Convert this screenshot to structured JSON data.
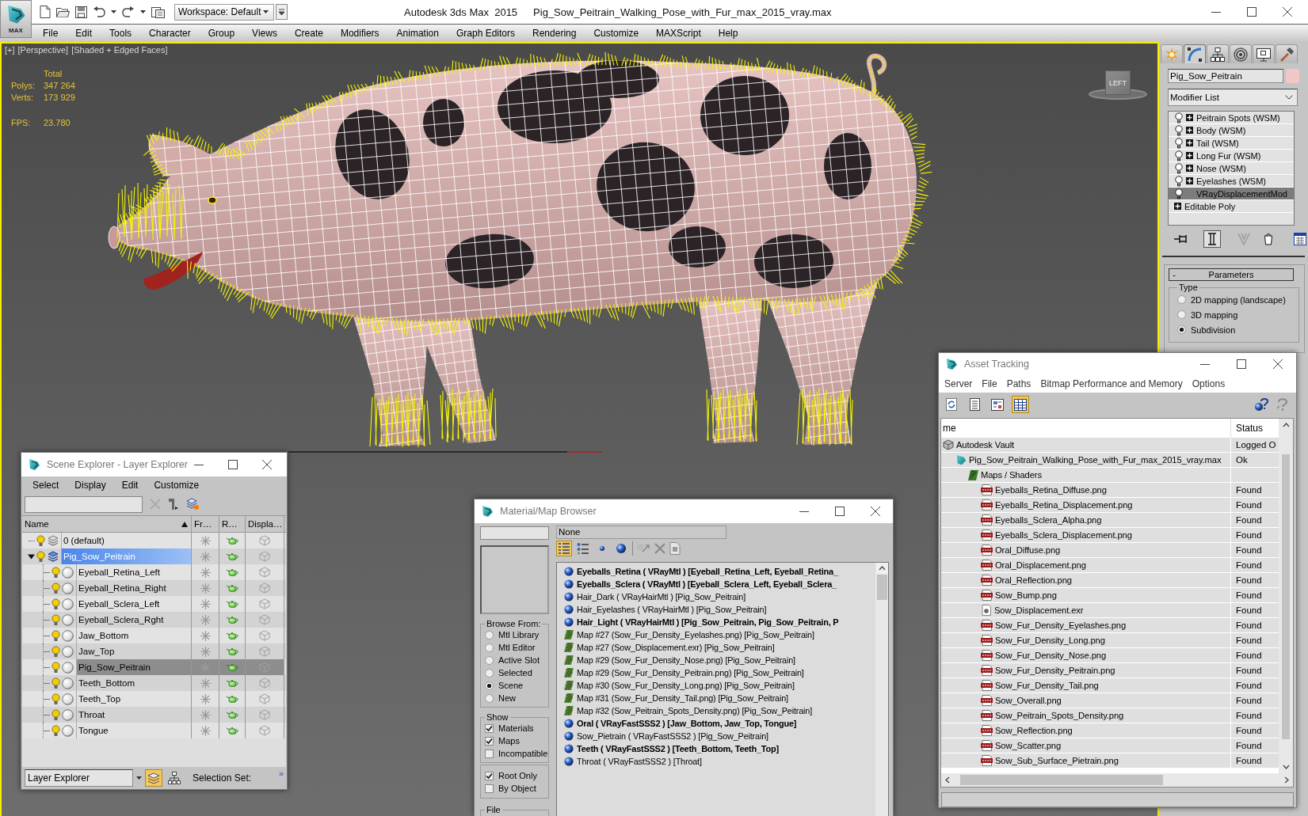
{
  "title_bar": {
    "logo_text": "MAX",
    "workspace": "Workspace: Default",
    "app_name": "Autodesk 3ds Max  2015",
    "file_name": "Pig_Sow_Peitrain_Walking_Pose_with_Fur_max_2015_vray.max"
  },
  "menu_bar": [
    "File",
    "Edit",
    "Tools",
    "Character",
    "Group",
    "Views",
    "Create",
    "Modifiers",
    "Animation",
    "Graph Editors",
    "Rendering",
    "Customize",
    "MAXScript",
    "Help"
  ],
  "viewport": {
    "labels": [
      "[+]",
      "[Perspective]",
      "[Shaded + Edged Faces]"
    ],
    "stats": {
      "header": "Total",
      "rows": [
        {
          "label": "Polys:",
          "value": "347 264"
        },
        {
          "label": "Verts:",
          "value": "173 929"
        }
      ]
    },
    "fps": {
      "label": "FPS:",
      "value": "23.780"
    },
    "viewcube_label": "LEFT"
  },
  "command_panel": {
    "tabs": [
      {
        "kind": "create",
        "selected": false
      },
      {
        "kind": "modify",
        "selected": true
      },
      {
        "kind": "hierarchy",
        "selected": false
      },
      {
        "kind": "motion",
        "selected": false
      },
      {
        "kind": "display",
        "selected": false
      },
      {
        "kind": "utilities",
        "selected": false
      }
    ],
    "object_name": "Pig_Sow_Peitrain",
    "modifier_list": "Modifier List",
    "modifier_stack": [
      {
        "kind": "modifier",
        "label": "Peitrain Spots (WSM)",
        "expandable": true,
        "selected": false
      },
      {
        "kind": "modifier",
        "label": "Body (WSM)",
        "expandable": true,
        "selected": false
      },
      {
        "kind": "modifier",
        "label": "Tail (WSM)",
        "expandable": true,
        "selected": false
      },
      {
        "kind": "modifier",
        "label": "Long Fur (WSM)",
        "expandable": true,
        "selected": false
      },
      {
        "kind": "modifier",
        "label": "Nose (WSM)",
        "expandable": true,
        "selected": false
      },
      {
        "kind": "modifier",
        "label": "Eyelashes (WSM)",
        "expandable": true,
        "selected": false
      },
      {
        "kind": "modifier",
        "label": "VRayDisplacementMod",
        "expandable": false,
        "selected": true
      },
      {
        "kind": "base",
        "label": "Editable Poly",
        "expandable": true,
        "selected": false
      }
    ],
    "stack_tools": [
      {
        "kind": "pin",
        "on": false,
        "disabled": false
      },
      {
        "kind": "end-result",
        "on": true,
        "disabled": false
      },
      {
        "kind": "unique",
        "on": false,
        "disabled": true
      },
      {
        "kind": "remove",
        "on": false,
        "disabled": false
      },
      {
        "kind": "configure",
        "on": false,
        "disabled": false
      }
    ],
    "rollout": {
      "sign": "-",
      "title": "Parameters",
      "group": "Type",
      "options": [
        {
          "label": "2D mapping (landscape)",
          "selected": false
        },
        {
          "label": "3D mapping",
          "selected": false
        },
        {
          "label": "Subdivision",
          "selected": true
        }
      ]
    }
  },
  "scene_explorer": {
    "title": "Scene Explorer - Layer Explorer",
    "menu": [
      "Select",
      "Display",
      "Edit",
      "Customize"
    ],
    "columns": [
      {
        "label": "Name",
        "sorted": true
      },
      {
        "label": "Fr…",
        "sorted": false
      },
      {
        "label": "R…",
        "sorted": false
      },
      {
        "label": "Displa…",
        "sorted": false
      }
    ],
    "layers": [
      {
        "name": "0 (default)",
        "current": false,
        "selected": false
      },
      {
        "name": "Pig_Sow_Peitrain",
        "current": true,
        "selected": true,
        "expanded": true,
        "children": [
          {
            "name": "Eyeball_Retina_Left",
            "selected": false
          },
          {
            "name": "Eyeball_Retina_Right",
            "selected": false
          },
          {
            "name": "Eyeball_Sclera_Left",
            "selected": false
          },
          {
            "name": "Eyeball_Sclera_Rght",
            "selected": false
          },
          {
            "name": "Jaw_Bottom",
            "selected": false
          },
          {
            "name": "Jaw_Top",
            "selected": false
          },
          {
            "name": "Pig_Sow_Peitrain",
            "selected": true
          },
          {
            "name": "Teeth_Bottom",
            "selected": false
          },
          {
            "name": "Teeth_Top",
            "selected": false
          },
          {
            "name": "Throat",
            "selected": false
          },
          {
            "name": "Tongue",
            "selected": false
          }
        ]
      }
    ],
    "footer": {
      "explorer": "Layer Explorer",
      "modes": [
        {
          "kind": "layers",
          "on": true
        },
        {
          "kind": "hierarchy",
          "on": false
        }
      ],
      "selection_set": "Selection Set:",
      "more": "»"
    }
  },
  "material_browser": {
    "title": "Material/Map Browser",
    "name_field": "None",
    "view_buttons": [
      {
        "kind": "list",
        "on": true
      },
      {
        "kind": "list-icons",
        "on": false
      },
      {
        "kind": "small-icons",
        "on": false
      },
      {
        "kind": "large-icons",
        "on": false
      }
    ],
    "browse_from": {
      "label": "Browse From:",
      "options": [
        {
          "label": "Mtl Library",
          "selected": false
        },
        {
          "label": "Mtl Editor",
          "selected": false
        },
        {
          "label": "Active Slot",
          "selected": false
        },
        {
          "label": "Selected",
          "selected": false
        },
        {
          "label": "Scene",
          "selected": true
        },
        {
          "label": "New",
          "selected": false
        }
      ]
    },
    "show": {
      "label": "Show",
      "options": [
        {
          "label": "Materials",
          "checked": true
        },
        {
          "label": "Maps",
          "checked": true
        },
        {
          "label": "Incompatible",
          "checked": false
        }
      ]
    },
    "root_options": [
      {
        "label": "Root Only",
        "checked": true
      },
      {
        "label": "By Object",
        "checked": false
      }
    ],
    "file_label": "File",
    "entries": [
      {
        "kind": "material",
        "bold": true,
        "text": "Eyeballs_Retina ( VRayMtl ) [Eyeball_Retina_Left, Eyeball_Retina_"
      },
      {
        "kind": "material",
        "bold": true,
        "text": "Eyeballs_Sclera ( VRayMtl ) [Eyeball_Sclera_Left, Eyeball_Sclera_"
      },
      {
        "kind": "material",
        "bold": false,
        "text": "Hair_Dark ( VRayHairMtl ) [Pig_Sow_Peitrain]"
      },
      {
        "kind": "material",
        "bold": false,
        "text": "Hair_Eyelashes ( VRayHairMtl ) [Pig_Sow_Peitrain]"
      },
      {
        "kind": "material",
        "bold": true,
        "text": "Hair_Light ( VRayHairMtl ) [Pig_Sow_Peitrain, Pig_Sow_Peitrain, P"
      },
      {
        "kind": "map",
        "bold": false,
        "text": "Map #27 (Sow_Fur_Density_Eyelashes.png) [Pig_Sow_Peitrain]"
      },
      {
        "kind": "map",
        "bold": false,
        "text": "Map #27 (Sow_Displacement.exr) [Pig_Sow_Peitrain]"
      },
      {
        "kind": "map",
        "bold": false,
        "text": "Map #29 (Sow_Fur_Density_Nose.png) [Pig_Sow_Peitrain]"
      },
      {
        "kind": "map",
        "bold": false,
        "text": "Map #29 (Sow_Fur_Density_Peitrain.png) [Pig_Sow_Peitrain]"
      },
      {
        "kind": "map",
        "bold": false,
        "text": "Map #30 (Sow_Fur_Density_Long.png) [Pig_Sow_Peitrain]"
      },
      {
        "kind": "map",
        "bold": false,
        "text": "Map #31 (Sow_Fur_Density_Tail.png) [Pig_Sow_Peitrain]"
      },
      {
        "kind": "map",
        "bold": false,
        "text": "Map #32 (Sow_Peitrain_Spots_Density.png) [Pig_Sow_Peitrain]"
      },
      {
        "kind": "material",
        "bold": true,
        "text": "Oral ( VRayFastSSS2 ) [Jaw_Bottom, Jaw_Top, Tongue]"
      },
      {
        "kind": "material",
        "bold": false,
        "text": "Sow_Pietrain ( VRayFastSSS2 ) [Pig_Sow_Peitrain]"
      },
      {
        "kind": "material",
        "bold": true,
        "text": "Teeth ( VRayFastSSS2 ) [Teeth_Bottom, Teeth_Top]"
      },
      {
        "kind": "material",
        "bold": false,
        "text": "Throat ( VRayFastSSS2 ) [Throat]"
      }
    ]
  },
  "asset_tracking": {
    "title": "Asset Tracking",
    "menu": [
      "Server",
      "File",
      "Paths",
      "Bitmap Performance and Memory",
      "Options"
    ],
    "toolbar": [
      {
        "kind": "refresh",
        "on": false
      },
      {
        "kind": "list",
        "on": false
      },
      {
        "kind": "thumbnails",
        "on": false
      },
      {
        "kind": "table",
        "on": true
      }
    ],
    "columns": [
      "me",
      "Status"
    ],
    "tree": [
      {
        "kind": "vault",
        "name": "Autodesk Vault",
        "status": "Logged O",
        "children": [
          {
            "kind": "scene",
            "name": "Pig_Sow_Peitrain_Walking_Pose_with_Fur_max_2015_vray.max",
            "status": "Ok",
            "children": [
              {
                "kind": "folder",
                "name": "Maps / Shaders",
                "children": [
                  {
                    "kind": "png",
                    "name": "Eyeballs_Retina_Diffuse.png",
                    "status": "Found"
                  },
                  {
                    "kind": "png",
                    "name": "Eyeballs_Retina_Displacement.png",
                    "status": "Found"
                  },
                  {
                    "kind": "png",
                    "name": "Eyeballs_Sclera_Alpha.png",
                    "status": "Found"
                  },
                  {
                    "kind": "png",
                    "name": "Eyeballs_Sclera_Displacement.png",
                    "status": "Found"
                  },
                  {
                    "kind": "png",
                    "name": "Oral_Diffuse.png",
                    "status": "Found"
                  },
                  {
                    "kind": "png",
                    "name": "Oral_Displacement.png",
                    "status": "Found"
                  },
                  {
                    "kind": "png",
                    "name": "Oral_Reflection.png",
                    "status": "Found"
                  },
                  {
                    "kind": "png",
                    "name": "Sow_Bump.png",
                    "status": "Found"
                  },
                  {
                    "kind": "exr",
                    "name": "Sow_Displacement.exr",
                    "status": "Found"
                  },
                  {
                    "kind": "png",
                    "name": "Sow_Fur_Density_Eyelashes.png",
                    "status": "Found"
                  },
                  {
                    "kind": "png",
                    "name": "Sow_Fur_Density_Long.png",
                    "status": "Found"
                  },
                  {
                    "kind": "png",
                    "name": "Sow_Fur_Density_Nose.png",
                    "status": "Found"
                  },
                  {
                    "kind": "png",
                    "name": "Sow_Fur_Density_Peitrain.png",
                    "status": "Found"
                  },
                  {
                    "kind": "png",
                    "name": "Sow_Fur_Density_Tail.png",
                    "status": "Found"
                  },
                  {
                    "kind": "png",
                    "name": "Sow_Overall.png",
                    "status": "Found"
                  },
                  {
                    "kind": "png",
                    "name": "Sow_Peitrain_Spots_Density.png",
                    "status": "Found"
                  },
                  {
                    "kind": "png",
                    "name": "Sow_Reflection.png",
                    "status": "Found"
                  },
                  {
                    "kind": "png",
                    "name": "Sow_Scatter.png",
                    "status": "Found"
                  },
                  {
                    "kind": "png",
                    "name": "Sow_Sub_Surface_Pietrain.png",
                    "status": "Found"
                  }
                ]
              }
            ]
          }
        ]
      }
    ]
  }
}
